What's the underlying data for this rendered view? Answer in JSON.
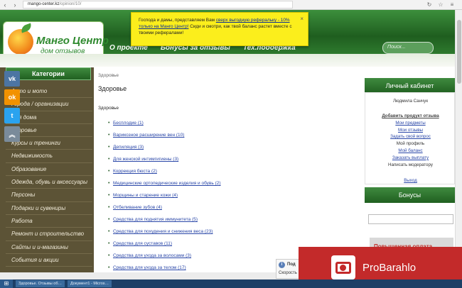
{
  "browser": {
    "back": "‹",
    "forward": "›",
    "url_host": "mango-center.kz",
    "url_path": "/opinion/10/",
    "icons": [
      "↻",
      "☆",
      "≡"
    ]
  },
  "header": {
    "logo_title": "Манго Центр",
    "logo_sub": "дом отзывов",
    "nav": [
      "О проекте",
      "Бонусы за отзывы",
      "Тех.поддержка"
    ],
    "search_placeholder": "Поиск..."
  },
  "notice": {
    "text_before": "Господа и дамы, представляем Вам ",
    "link": "сверх выгодную реферальку - 10% только на Манго Центр!",
    "text_after": " Сиди и смотри, как твой баланс растет вместе с твоими рефералами!",
    "close": "×"
  },
  "social": [
    "vk",
    "ok",
    "tw",
    "share"
  ],
  "sidebar": {
    "title": "Категории",
    "items": [
      "Авто и мото",
      "Города / организации",
      "Для дома",
      "Здоровье",
      "Курсы и тренинги",
      "Недвижимость",
      "Образование",
      "Одежда, обувь и аксессуары",
      "Персоны",
      "Подарки и сувениры",
      "Работа",
      "Ремонт и строительство",
      "Сайты и и-магазины",
      "События и акции"
    ]
  },
  "main": {
    "breadcrumb": "Здоровье",
    "title": "Здоровье",
    "subtitle": "Здоровье",
    "categories": [
      "Бесплодие (1)",
      "Варикозное расширение вен (10)",
      "Депиляция (3)",
      "Для женской интимгигиены (3)",
      "Коррекция бюста (2)",
      "Медицинские ортопедические изделия и обувь (2)",
      "Морщины и старение кожи (4)",
      "Отбеливание зубов (4)",
      "Средства для поднятия иммунитета (5)",
      "Средства для похудения и снижения веса (23)",
      "Средства для суставов (11)",
      "Средства для ухода за волосами (3)",
      "Средства для ухода за телом (17)"
    ]
  },
  "right": {
    "cabinet_title": "Личный кабинет",
    "user": "Людмила Санчук",
    "links": [
      "Добавить продукт отзыва",
      "Мои предметы",
      "Мои отзывы",
      "Задать свой вопрос",
      "Мой профиль",
      "Мой баланс",
      "Заказать выплату",
      "Написать модератору"
    ],
    "logout": "Выход",
    "bonus_title": "Бонусы",
    "promo": "Повышенная оплата"
  },
  "tooltip": {
    "icon": "i",
    "t1": "Под",
    "t2": "Скорость"
  },
  "overlay": {
    "brand": "ProBarahlo"
  },
  "taskbar": {
    "tasks": [
      "Здоровье. Отзывы об…",
      "Документ1 - Micros…"
    ]
  }
}
